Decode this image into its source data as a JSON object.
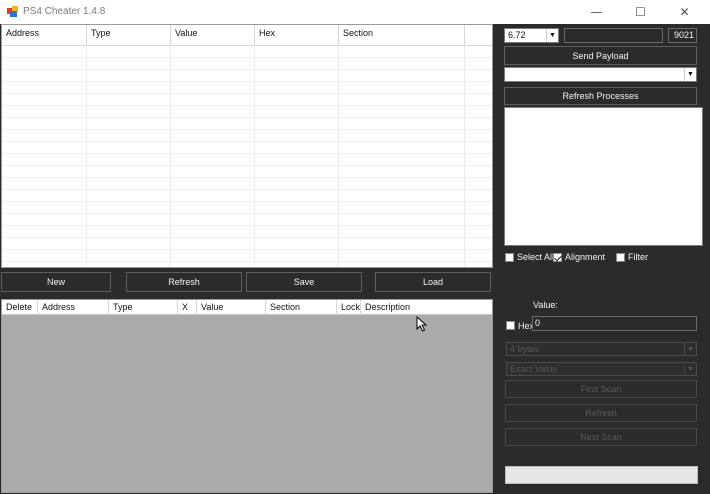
{
  "window": {
    "title": "PS4 Cheater 1.4.8",
    "minimize_glyph": "—",
    "maximize_glyph": "☐",
    "close_glyph": "✕"
  },
  "result_table": {
    "columns": [
      "Address",
      "Type",
      "Value",
      "Hex",
      "Section"
    ]
  },
  "toolbar": {
    "new_label": "New",
    "refresh_label": "Refresh",
    "save_label": "Save",
    "load_label": "Load"
  },
  "saved_table": {
    "columns": [
      "Delete",
      "Address",
      "Type",
      "X",
      "Value",
      "Section",
      "Lock",
      "Description"
    ]
  },
  "connection": {
    "version_selected": "6.72",
    "ip_value": "",
    "port_value": "9021",
    "send_payload_label": "Send Payload",
    "process_selected": "",
    "refresh_processes_label": "Refresh Processes"
  },
  "filters": {
    "select_all_label": "Select All",
    "select_all_checked": false,
    "alignment_label": "Alignment",
    "alignment_checked": true,
    "filter_label": "Filter",
    "filter_checked": false
  },
  "scan": {
    "value_label": "Value:",
    "hex_label": "Hex",
    "hex_checked": false,
    "value_input": "0",
    "value_type_selected": "4 bytes",
    "compare_type_selected": "Exact Value",
    "first_scan_label": "First Scan",
    "refresh_label": "Refresh",
    "next_scan_label": "Next Scan",
    "progress_percent": 0
  },
  "colors": {
    "background": "#2b2b2b",
    "progress_fill": "#06b025"
  }
}
